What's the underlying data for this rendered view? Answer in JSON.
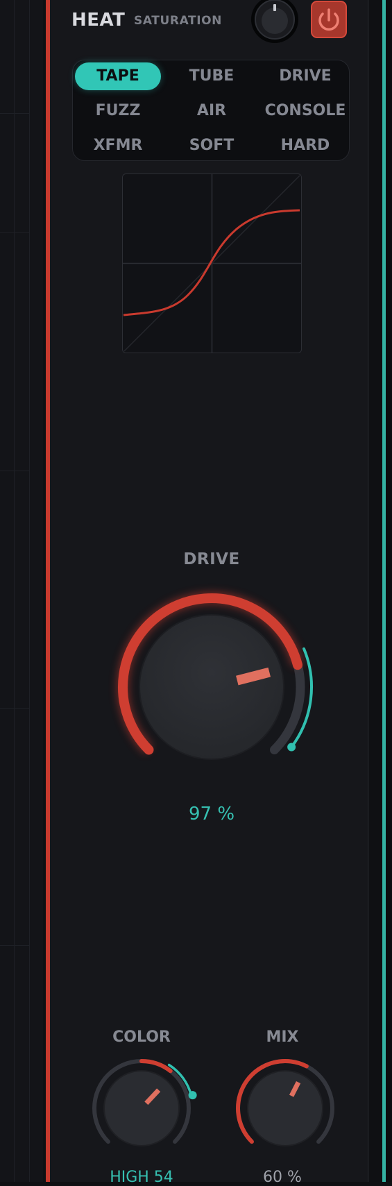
{
  "header": {
    "title": "HEAT",
    "subtitle": "SATURATION"
  },
  "modes": [
    {
      "label": "TAPE",
      "active": true
    },
    {
      "label": "TUBE",
      "active": false
    },
    {
      "label": "DRIVE",
      "active": false
    },
    {
      "label": "FUZZ",
      "active": false
    },
    {
      "label": "AIR",
      "active": false
    },
    {
      "label": "CONSOLE",
      "active": false
    },
    {
      "label": "XFMR",
      "active": false
    },
    {
      "label": "SOFT",
      "active": false
    },
    {
      "label": "HARD",
      "active": false
    }
  ],
  "knobs": {
    "drive": {
      "label": "DRIVE",
      "value_text": "97 %",
      "level": 0.78,
      "accent_level": 0.97
    },
    "color": {
      "label": "COLOR",
      "value_text": "HIGH 54",
      "level": 0.54,
      "accent_level": 0.7
    },
    "mix": {
      "label": "MIX",
      "value_text": "60 %",
      "level": 0.6
    }
  },
  "icons": {
    "power": "power-icon",
    "input_trim": "mini-knob-icon"
  },
  "colors": {
    "accent_red": "#c93a2e",
    "accent_teal": "#35b3a3",
    "panel": "#16171b",
    "background": "#0f1013"
  }
}
